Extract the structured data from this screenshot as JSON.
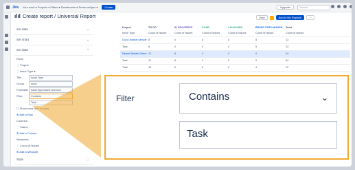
{
  "topbar": {
    "logo": "Jira",
    "nav": "Your work ▾   Projects ▾   Filters ▾   Dashboards ▾   Teams ▾   Apps ▾",
    "create": "Create",
    "upgrade": "Upgrade",
    "search_placeholder": "Search"
  },
  "page": {
    "title": "Create report / Universal Report",
    "view": "View",
    "add": "Add to My Reports",
    "more": "···"
  },
  "panel": {
    "sections": {
      "data": "Set data",
      "chart": "Set chart",
      "style": "Style"
    },
    "rows_label": "Rows",
    "project": "Project",
    "issue_type": "Issue Type",
    "title_label": "Title",
    "title_value": "Issue Type",
    "group_label": "Group",
    "group_value": "none",
    "formatter_label": "Formatter",
    "formatter_value": "IssueType Name and icon",
    "filter_label": "Filter",
    "filter_value": "Contains",
    "filter_text": "Task",
    "hide_rows": "Show rows with no data",
    "add_row": "Add a Row",
    "columns_label": "Columns",
    "status": "Status",
    "add_column": "Add a Column",
    "measures_label": "Measures",
    "count": "Count of Issues",
    "add_measure": "Add a Measure"
  },
  "table": {
    "headers": [
      "Project",
      "TO DO",
      "IN PROGRESS",
      "DONE",
      "LAUNCHED",
      "READY FOR LAUNCH",
      "Total"
    ],
    "sub": [
      "Issue Type",
      "Count of Issues",
      "Count of Issues",
      "Count of Issues",
      "Count of Issues",
      "Count of Issues",
      "Count of Issues"
    ],
    "rows": [
      [
        "Go-to-market sample",
        "8",
        "0",
        "0",
        "0",
        "5",
        "13"
      ],
      [
        "Task",
        "8",
        "0",
        "0",
        "0",
        "5",
        "13"
      ],
      [
        "Report Builder Demo",
        "12",
        "8",
        "4",
        "0",
        "0",
        "24"
      ],
      [
        "Task",
        "12",
        "8",
        "4",
        "0",
        "0",
        "24"
      ],
      [
        "Total",
        "18",
        "0",
        "0",
        "0",
        "4",
        "22"
      ]
    ]
  },
  "zoom": {
    "filter_label": "Filter",
    "select_value": "Contains",
    "text_value": "Task"
  },
  "colors": {
    "accent": "#f0a830",
    "brand": "#0052cc"
  }
}
